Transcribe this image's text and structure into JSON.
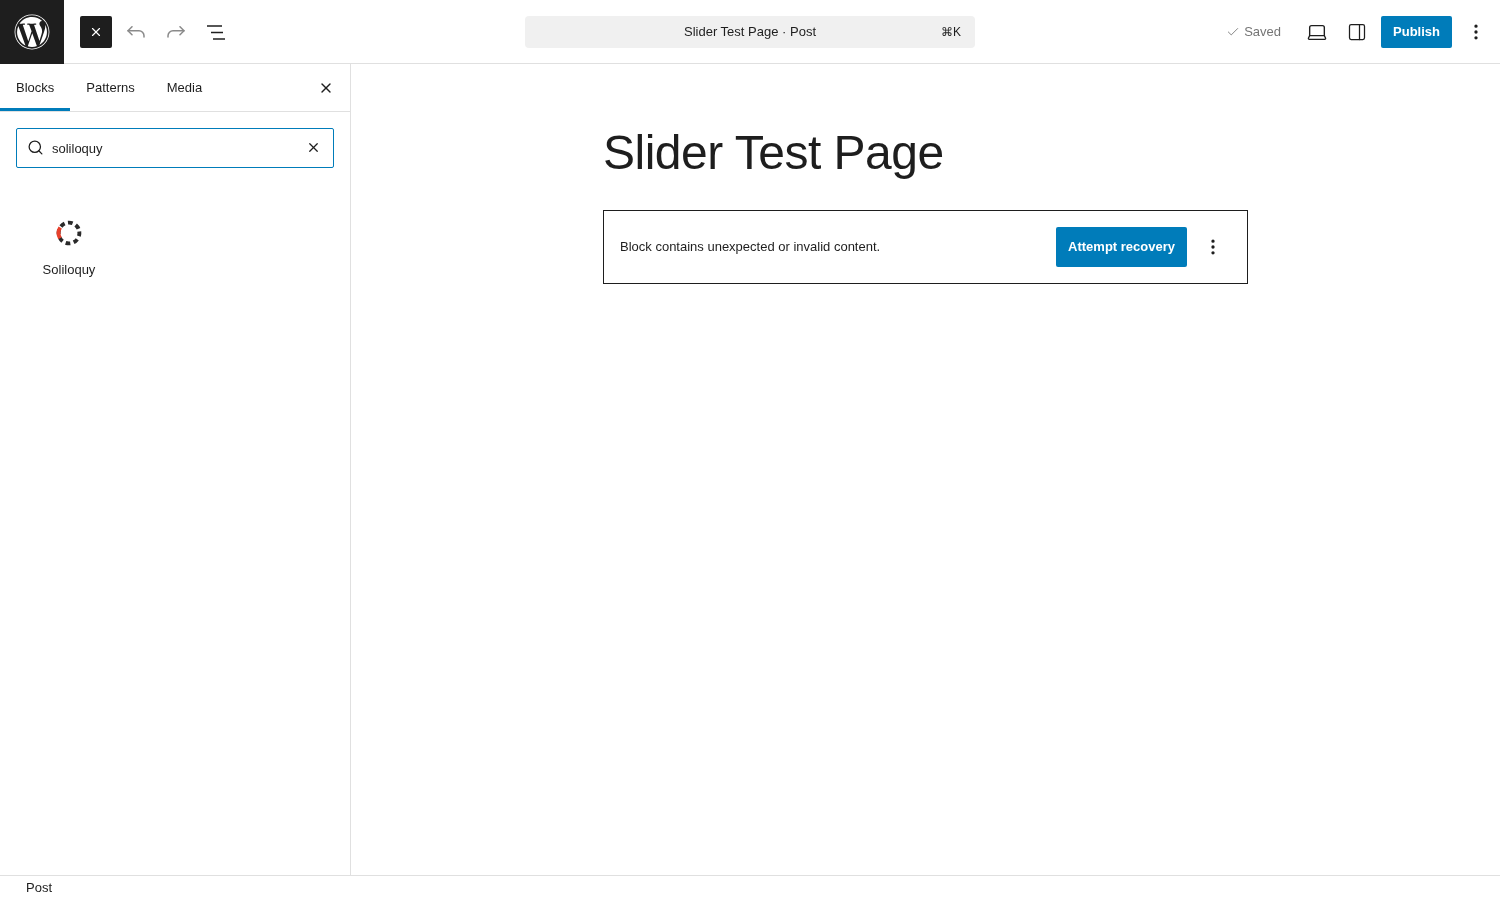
{
  "top_bar": {
    "inserter_toggle": {
      "pressed": true
    },
    "undo": {
      "disabled": true
    },
    "redo": {
      "disabled": true
    },
    "command_bar": {
      "title": "Slider Test Page · Post",
      "shortcut": "⌘K"
    },
    "save_status": "Saved",
    "publish_button": "Publish"
  },
  "inserter": {
    "tabs": [
      {
        "label": "Blocks",
        "selected": true
      },
      {
        "label": "Patterns",
        "selected": false
      },
      {
        "label": "Media",
        "selected": false
      }
    ],
    "search": {
      "value": "soliloquy"
    },
    "results": [
      {
        "label": "Soliloquy"
      }
    ]
  },
  "editor": {
    "title": "Slider Test Page",
    "warning": {
      "message": "Block contains unexpected or invalid content.",
      "action": "Attempt recovery"
    }
  },
  "footer": {
    "breadcrumb": "Post"
  }
}
